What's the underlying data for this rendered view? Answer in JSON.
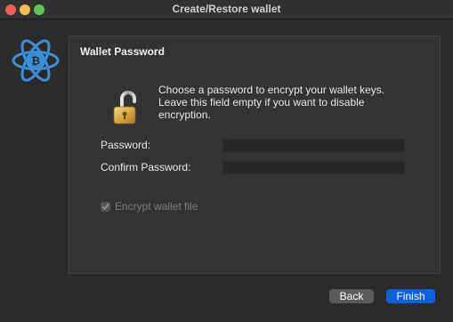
{
  "window": {
    "title": "Create/Restore wallet"
  },
  "icons": {
    "logo": "electrum-bitcoin-atom-icon",
    "lock": "open-padlock-icon",
    "check": "checkmark-icon"
  },
  "panel": {
    "title": "Wallet Password",
    "instructions": [
      "Choose a password to encrypt your wallet keys.",
      "Leave this field empty if you want to disable",
      "encryption."
    ],
    "password_label": "Password:",
    "password_value": "",
    "confirm_label": "Confirm Password:",
    "confirm_value": "",
    "encrypt_checkbox": {
      "label": "Encrypt wallet file",
      "checked": true,
      "enabled": false
    }
  },
  "buttons": {
    "back": "Back",
    "finish": "Finish"
  },
  "colors": {
    "accent": "#0a62d6",
    "logo_blue": "#3c8ed6",
    "close": "#ee5f57",
    "minimize": "#f5bd4f",
    "maximize": "#5fc454"
  }
}
